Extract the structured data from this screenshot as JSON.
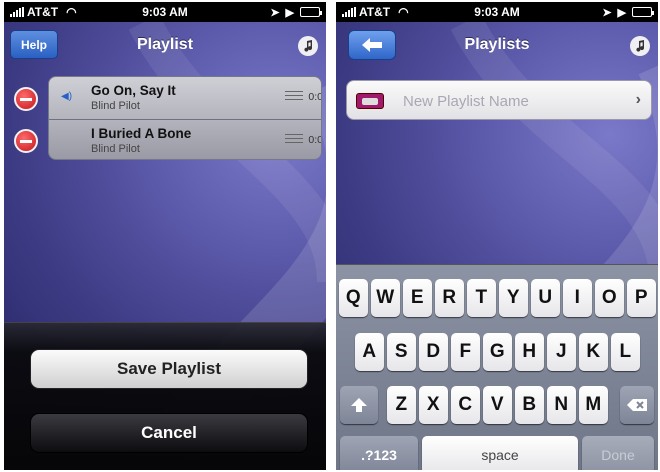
{
  "left_screen": {
    "status": {
      "carrier": "AT&T",
      "time": "9:03 AM"
    },
    "nav": {
      "help_label": "Help",
      "title": "Playlist",
      "note_icon": "music-note-icon"
    },
    "songs": [
      {
        "title": "Go On, Say It",
        "artist": "Blind Pilot",
        "duration": "0:0",
        "playing": true
      },
      {
        "title": "I Buried A Bone",
        "artist": "Blind Pilot",
        "duration": "0:0",
        "playing": false
      }
    ],
    "action_sheet": {
      "save_label": "Save Playlist",
      "cancel_label": "Cancel"
    }
  },
  "right_screen": {
    "status": {
      "carrier": "AT&T",
      "time": "9:03 AM"
    },
    "nav": {
      "title": "Playlists",
      "back_icon": "back-arrow-icon",
      "note_icon": "music-note-icon"
    },
    "new_playlist": {
      "placeholder": "New Playlist Name",
      "value": ""
    },
    "keyboard": {
      "row1": [
        "Q",
        "W",
        "E",
        "R",
        "T",
        "Y",
        "U",
        "I",
        "O",
        "P"
      ],
      "row2": [
        "A",
        "S",
        "D",
        "F",
        "G",
        "H",
        "J",
        "K",
        "L"
      ],
      "row3": [
        "Z",
        "X",
        "C",
        "V",
        "B",
        "N",
        "M"
      ],
      "numbers_label": ".?123",
      "space_label": "space",
      "done_label": "Done"
    }
  },
  "colors": {
    "accent_blue": "#2a60c2",
    "delete_red": "#c4161c",
    "background": "#3c3a82"
  }
}
